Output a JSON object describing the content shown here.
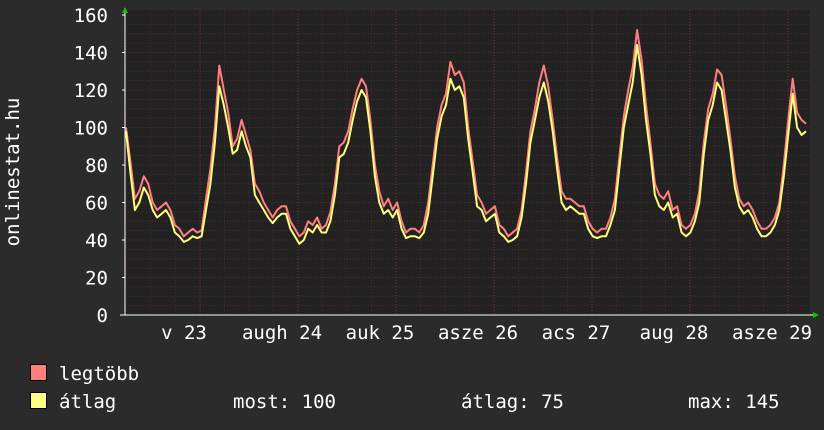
{
  "side_label": "onlinestat.hu",
  "legend": {
    "items": [
      {
        "label": "legtöbb",
        "color": "#ff7f7f"
      },
      {
        "label": "átlag",
        "color": "#ffff7f"
      }
    ]
  },
  "stats": {
    "most": "most: 100",
    "atlag": "átlag: 75",
    "max": "max: 145"
  },
  "colors": {
    "background": "#2b2b2b",
    "plot_bg": "#222222",
    "grid": "#5a2a2a",
    "axis": "#ffffff",
    "arrow": "#00cc00"
  },
  "chart_data": {
    "type": "line",
    "ylim": [
      0,
      160
    ],
    "yticks": [
      0,
      20,
      40,
      60,
      80,
      100,
      120,
      140,
      160
    ],
    "x_tick_labels": [
      "v 23",
      "augh 24",
      "auk 25",
      "asze 26",
      "acs 27",
      "aug 28",
      "asze 29"
    ],
    "grid": true,
    "series": [
      {
        "name": "legtöbb",
        "color": "#ff7f7f",
        "values": [
          100,
          82,
          62,
          66,
          74,
          70,
          60,
          56,
          58,
          60,
          56,
          48,
          46,
          42,
          44,
          46,
          44,
          45,
          62,
          78,
          100,
          133,
          120,
          108,
          90,
          94,
          104,
          96,
          88,
          70,
          66,
          60,
          56,
          52,
          56,
          58,
          58,
          50,
          46,
          42,
          44,
          50,
          48,
          52,
          46,
          48,
          55,
          70,
          90,
          92,
          98,
          110,
          120,
          126,
          122,
          104,
          80,
          66,
          58,
          62,
          56,
          60,
          50,
          44,
          46,
          46,
          44,
          48,
          60,
          80,
          100,
          112,
          118,
          135,
          128,
          130,
          124,
          100,
          82,
          64,
          60,
          54,
          56,
          58,
          48,
          46,
          42,
          44,
          46,
          56,
          76,
          98,
          110,
          124,
          133,
          122,
          104,
          84,
          66,
          62,
          62,
          60,
          58,
          58,
          50,
          46,
          44,
          46,
          46,
          52,
          62,
          84,
          106,
          120,
          132,
          152,
          136,
          112,
          92,
          70,
          64,
          62,
          66,
          56,
          58,
          48,
          46,
          48,
          54,
          66,
          92,
          110,
          118,
          131,
          128,
          112,
          94,
          74,
          62,
          58,
          60,
          56,
          50,
          46,
          46,
          48,
          52,
          60,
          80,
          104,
          126,
          108,
          104,
          102
        ]
      },
      {
        "name": "átlag",
        "color": "#ffff7f",
        "values": [
          98,
          76,
          56,
          60,
          68,
          64,
          56,
          52,
          54,
          56,
          52,
          44,
          42,
          39,
          40,
          42,
          41,
          42,
          56,
          70,
          92,
          122,
          112,
          100,
          86,
          88,
          98,
          90,
          84,
          64,
          60,
          56,
          52,
          49,
          52,
          54,
          54,
          46,
          42,
          38,
          40,
          46,
          44,
          48,
          44,
          44,
          50,
          64,
          84,
          86,
          92,
          104,
          114,
          120,
          116,
          98,
          74,
          60,
          54,
          56,
          52,
          56,
          46,
          41,
          42,
          42,
          41,
          44,
          54,
          74,
          94,
          106,
          112,
          126,
          120,
          122,
          116,
          94,
          76,
          58,
          56,
          50,
          52,
          54,
          44,
          42,
          39,
          40,
          42,
          52,
          70,
          92,
          104,
          116,
          124,
          114,
          98,
          78,
          60,
          56,
          58,
          56,
          54,
          54,
          46,
          42,
          41,
          42,
          42,
          48,
          56,
          78,
          100,
          112,
          124,
          144,
          128,
          104,
          86,
          64,
          58,
          56,
          60,
          52,
          54,
          44,
          42,
          44,
          50,
          60,
          86,
          104,
          112,
          124,
          120,
          104,
          88,
          68,
          58,
          54,
          56,
          52,
          46,
          42,
          42,
          44,
          48,
          56,
          74,
          96,
          118,
          100,
          96,
          98
        ]
      }
    ]
  }
}
